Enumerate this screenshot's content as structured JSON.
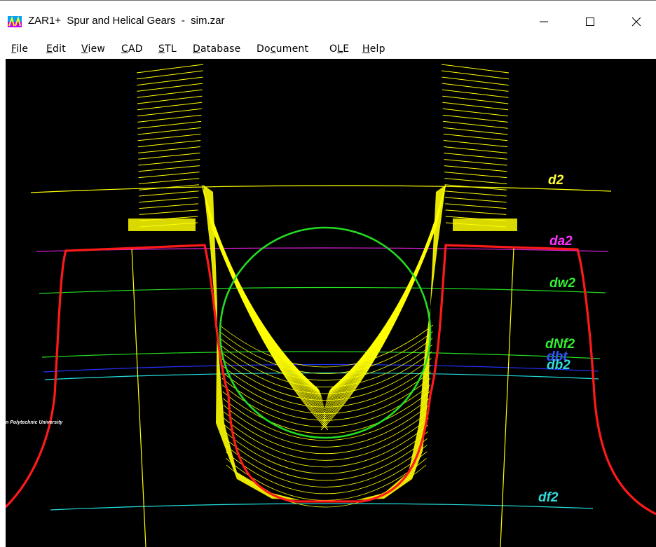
{
  "window": {
    "title": "ZAR1+  Spur and Helical Gears  -  sim.zar",
    "controls": {
      "minimize": "minimize-icon",
      "maximize": "maximize-icon",
      "close": "close-icon"
    }
  },
  "menu": {
    "items": [
      {
        "label": "File",
        "mnemonic": "F"
      },
      {
        "label": "Edit",
        "mnemonic": "E"
      },
      {
        "label": "View",
        "mnemonic": "V"
      },
      {
        "label": "CAD",
        "mnemonic": "C"
      },
      {
        "label": "STL",
        "mnemonic": "S"
      },
      {
        "label": "Database",
        "mnemonic": "D"
      },
      {
        "label": "Document",
        "mnemonic": "c"
      },
      {
        "label": "OLE",
        "mnemonic": "L"
      },
      {
        "label": "Help",
        "mnemonic": "H"
      }
    ]
  },
  "drawing": {
    "background": "#000000",
    "labels": [
      {
        "id": "d2",
        "text": "d2",
        "color": "#ffff33"
      },
      {
        "id": "da2",
        "text": "da2",
        "color": "#ff33ff"
      },
      {
        "id": "dw2",
        "text": "dw2",
        "color": "#33ee33"
      },
      {
        "id": "dNf2",
        "text": "dNf2",
        "color": "#33ee33"
      },
      {
        "id": "dbt",
        "text": "dbt",
        "color": "#3355ff"
      },
      {
        "id": "db2",
        "text": "db2",
        "color": "#33dddd"
      },
      {
        "id": "df2",
        "text": "df2",
        "color": "#33dddd"
      }
    ],
    "watermark": "n Polytechnic University",
    "colors": {
      "tooth_profile": "#ff1a1a",
      "envelope": "#ffff00",
      "circle": "#22dd22",
      "tip_line": "#dd22dd",
      "base_line": "#2233ff",
      "root_line": "#22dddd"
    }
  }
}
